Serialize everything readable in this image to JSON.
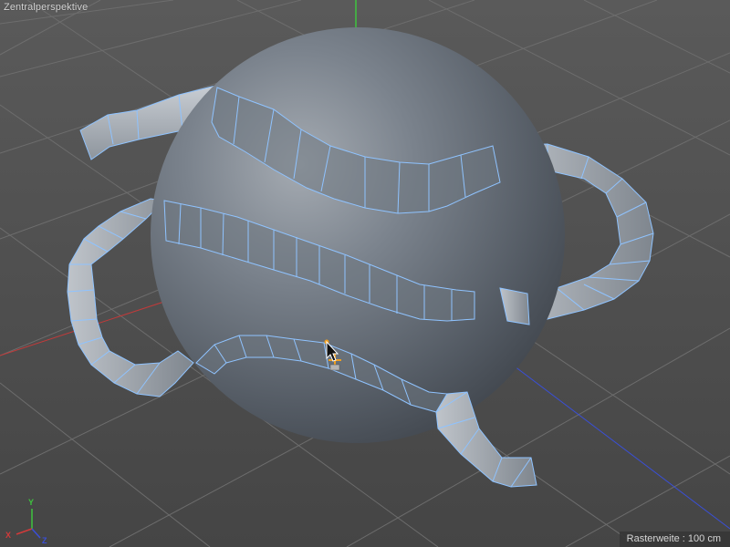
{
  "viewport": {
    "camera_label": "Zentralperspektive",
    "grid_info_label": "Rasterweite",
    "grid_info_separator": " : ",
    "grid_info_value": "100 cm"
  },
  "axes": {
    "x_label": "X",
    "y_label": "Y",
    "z_label": "Z",
    "x_color": "#d23a3a",
    "y_color": "#3ec43e",
    "z_color": "#3a4fd6"
  },
  "scene": {
    "object": "sphere",
    "ribbons": "spline-extruded bands (selected, blue edges)",
    "selection_edge_color": "#8fc3ff",
    "handle_color": "#f0a020",
    "sphere_color": "#7f8893"
  }
}
